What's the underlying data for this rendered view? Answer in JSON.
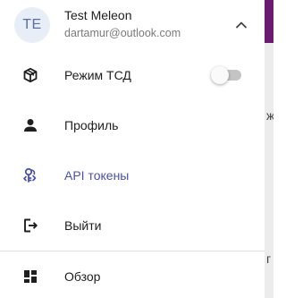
{
  "account": {
    "initials": "TE",
    "name": "Test Meleon",
    "email": "dartamur@outlook.com"
  },
  "menu": {
    "items": [
      {
        "label": "Режим ТСД",
        "icon": "cube-icon",
        "toggle": {
          "enabled": false
        }
      },
      {
        "label": "Профиль",
        "icon": "person-icon"
      },
      {
        "label": "API токены",
        "icon": "api-token-icon",
        "active": true
      },
      {
        "label": "Выйти",
        "icon": "logout-icon"
      }
    ],
    "nav": [
      {
        "label": "Обзор",
        "icon": "dashboard-icon"
      }
    ]
  },
  "colors": {
    "accent": "#4a4fb0",
    "avatar_bg": "#e8eef7",
    "avatar_text": "#5a6fa5"
  }
}
